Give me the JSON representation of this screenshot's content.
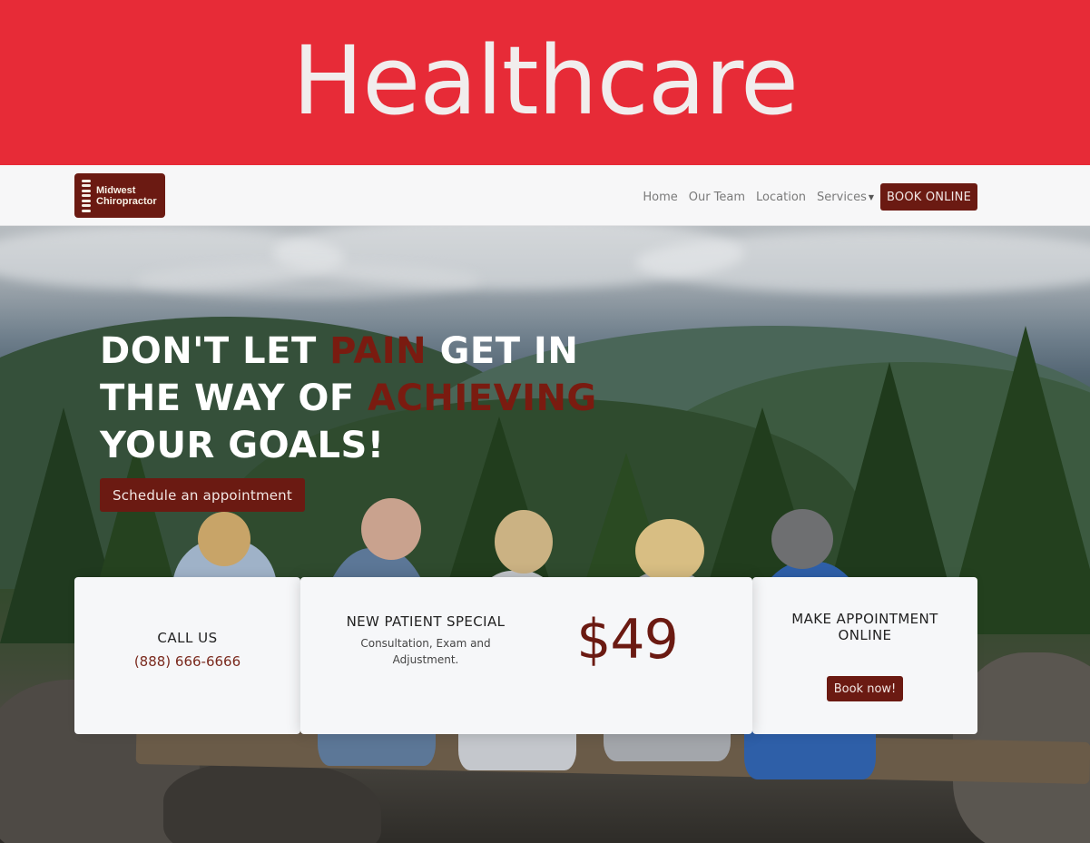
{
  "banner": {
    "title": "Healthcare"
  },
  "navbar": {
    "logo_line1": "Midwest",
    "logo_line2": "Chiropractor",
    "links": [
      "Home",
      "Our Team",
      "Location",
      "Services"
    ],
    "book_online": "BOOK ONLINE"
  },
  "hero": {
    "heading_part1": "Don't let ",
    "heading_accent1": "pain",
    "heading_part2": " get in the way of ",
    "heading_accent2": "achieving",
    "heading_part3": " your goals!",
    "schedule_button": "Schedule an appointment"
  },
  "cards": {
    "call": {
      "title": "CALL US",
      "phone": "(888) 666-6666"
    },
    "special": {
      "title": "NEW PATIENT SPECIAL",
      "description": "Consultation, Exam and Adjustment.",
      "price": "$49"
    },
    "appointment": {
      "title": "MAKE APPOINTMENT ONLINE",
      "button": "Book now!"
    }
  },
  "colors": {
    "banner": "#e72b37",
    "brand": "#6b1a12",
    "accent_text": "#7a1b10",
    "card_bg": "#f6f7f9"
  },
  "icons": {
    "nav_caret": "caret-down-icon",
    "logo_mark": "spine-icon"
  }
}
